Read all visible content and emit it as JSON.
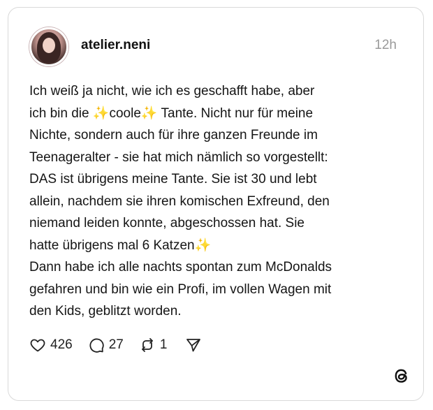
{
  "post": {
    "username": "atelier.neni",
    "timestamp": "12h",
    "text_lines": [
      "Ich weiß ja nicht, wie ich es geschafft habe, aber",
      "ich bin die ✨coole✨ Tante. Nicht nur für meine",
      "Nichte, sondern auch für ihre ganzen Freunde im",
      "Teenageralter - sie hat mich nämlich so vorgestellt:",
      "DAS ist übrigens meine Tante. Sie ist 30 und lebt",
      "allein, nachdem sie ihren komischen Exfreund, den",
      "niemand leiden konnte, abgeschossen hat. Sie",
      "hatte übrigens mal 6 Katzen✨",
      "Dann habe ich alle nachts spontan zum McDonalds",
      "gefahren und bin wie ein Profi, im vollen Wagen mit",
      "den Kids, geblitzt worden."
    ]
  },
  "actions": {
    "likes": "426",
    "replies": "27",
    "reposts": "1"
  },
  "icons": {
    "like": "heart-icon",
    "reply": "comment-bubble-icon",
    "repost": "repost-icon",
    "share": "send-icon",
    "brand": "threads-logo-icon"
  },
  "colors": {
    "text": "#151515",
    "muted": "#9a9a9a",
    "border": "#d9d9d9"
  }
}
